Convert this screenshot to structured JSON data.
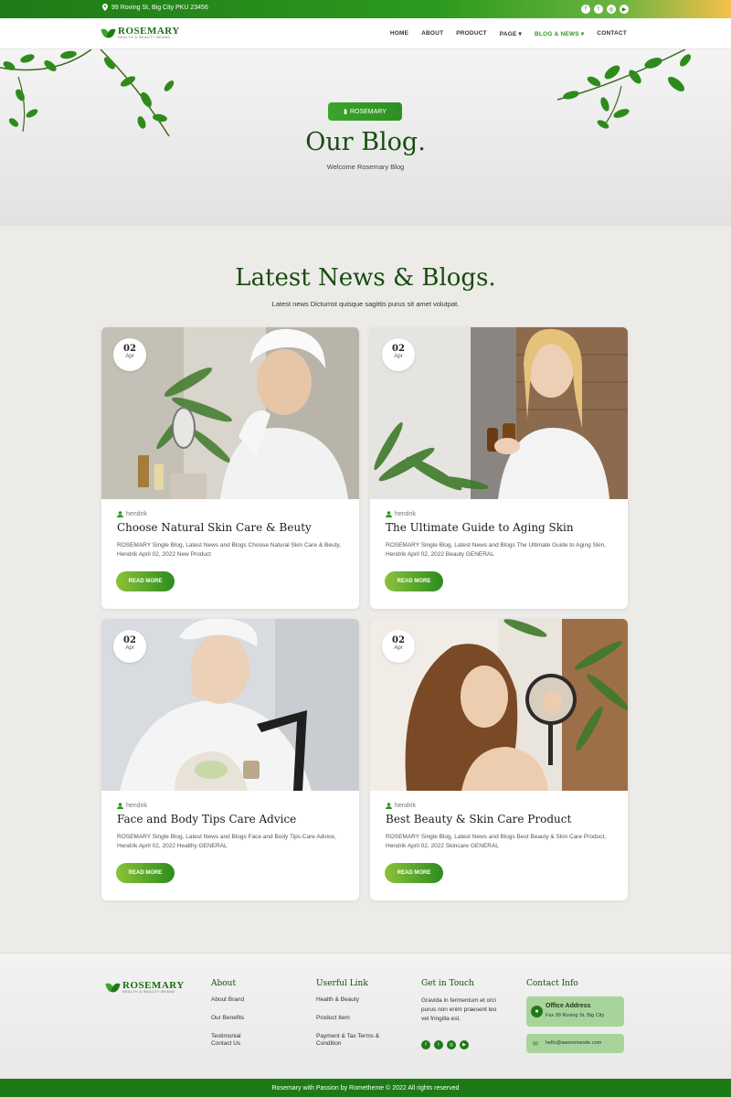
{
  "topbar": {
    "address": "99 Roving St, Big City PKU 23456",
    "social_icons": [
      "facebook-icon",
      "twitter-icon",
      "instagram-icon",
      "youtube-icon"
    ]
  },
  "brand": {
    "name": "ROSEMARY",
    "tagline": "HEALTH & BEAUTY BRAND"
  },
  "nav": {
    "home": "HOME",
    "about": "ABOUT",
    "product": "PRODUCT",
    "page": "PAGE",
    "blog": "BLOG & NEWS",
    "contact": "CONTACT"
  },
  "hero": {
    "pill": "ROSEMARY",
    "title": "Our Blog.",
    "subtitle": "Welcome Rosemary Blog"
  },
  "section": {
    "title": "Latest News & Blogs.",
    "subtitle": "Latest news Dictumst quisque sagittis purus sit amet volutpat."
  },
  "posts": [
    {
      "day": "02",
      "month": "Apr",
      "author": "hendrik",
      "title": "Choose Natural Skin Care & Beuty",
      "desc": "ROSEMARY Single Blog, Latest News and Blogs Choose Natural Skin Care & Beuty, Hendrik April 02, 2022 New Product",
      "button": "READ MORE"
    },
    {
      "day": "02",
      "month": "Apr",
      "author": "hendrik",
      "title": "The Ultimate Guide to Aging Skin",
      "desc": "ROSEMARY Single Blog, Latest News and Blogs The Ultimate Guide to Aging Skin, Hendrik April 02, 2022 Beauty GENERAL",
      "button": "READ MORE"
    },
    {
      "day": "02",
      "month": "Apr",
      "author": "hendrik",
      "title": "Face and Body Tips Care Advice",
      "desc": "ROSEMARY Single Blog, Latest News and Blogs Face and Body Tips Care Advice, Hendrik April 02, 2022 Healthy GENERAL",
      "button": "READ MORE"
    },
    {
      "day": "02",
      "month": "Apr",
      "author": "hendrik",
      "title": "Best Beauty & Skin Care Product",
      "desc": "ROSEMARY Single Blog, Latest News and Blogs Best Beauty & Skin Care Product, Hendrik April 02, 2022 Skincare GENERAL",
      "button": "READ MORE"
    }
  ],
  "footer": {
    "about": {
      "title": "About",
      "links": [
        "About Brand",
        "Our Benefits",
        "Testimonial Contact Us"
      ]
    },
    "useful": {
      "title": "Userful Link",
      "links": [
        "Health & Beauty",
        "Product Item",
        "Payment & Tax Terms & Condition"
      ]
    },
    "touch": {
      "title": "Get in Touch",
      "text": "Gravida in fermentum et orci purus non enim praesent leo vel fringilla est."
    },
    "contact": {
      "title": "Contact Info",
      "office_title": "Office Address",
      "office_text": "Fax 99 Roving St, Big City",
      "email": "hello@awesomesite.com"
    },
    "copyright": "Rosemary with Passion by Rometheme © 2022 All rights reserved"
  }
}
